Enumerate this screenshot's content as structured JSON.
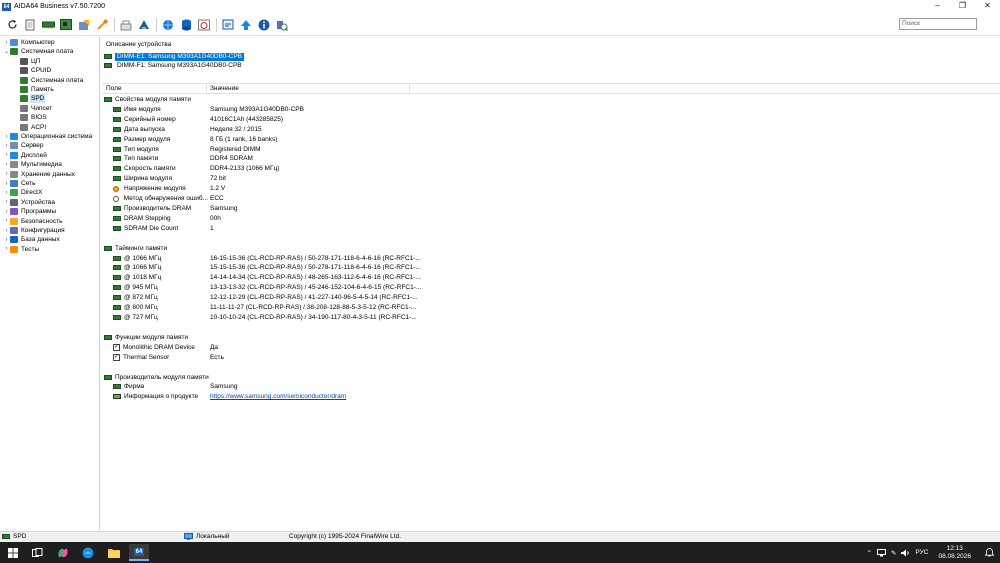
{
  "window": {
    "title": "AIDA64 Business v7.50.7200",
    "icon_text": "64",
    "minimize": "–",
    "maximize": "❐",
    "close": "✕"
  },
  "toolbar": {
    "buttons": [
      "refresh-icon",
      "report-icon",
      "memory-icon",
      "motherboard-icon",
      "favorites-icon",
      "cpu-icon",
      "wrench-icon",
      "user-icon",
      "network-icon",
      "database-icon",
      "benchmark-icon",
      "report-wizard-icon",
      "export-icon",
      "info-icon",
      "help-icon"
    ],
    "search_placeholder": "Поиск"
  },
  "tree": {
    "items": [
      {
        "label": "Компьютер",
        "indent": 0,
        "expand": "›",
        "icon_color": "#4a90d9"
      },
      {
        "label": "Системная плата",
        "indent": 0,
        "expand": "⌄",
        "icon_color": "#2e7d32"
      },
      {
        "label": "ЦП",
        "indent": 1,
        "expand": "",
        "icon_color": "#555555"
      },
      {
        "label": "CPUID",
        "indent": 1,
        "expand": "",
        "icon_color": "#555555"
      },
      {
        "label": "Системная плата",
        "indent": 1,
        "expand": "",
        "icon_color": "#2e7d32"
      },
      {
        "label": "Память",
        "indent": 1,
        "expand": "",
        "icon_color": "#2e7d32"
      },
      {
        "label": "SPD",
        "indent": 1,
        "expand": "",
        "icon_color": "#2e7d32",
        "selected": true
      },
      {
        "label": "Чипсет",
        "indent": 1,
        "expand": "",
        "icon_color": "#777777"
      },
      {
        "label": "BIOS",
        "indent": 1,
        "expand": "",
        "icon_color": "#777777"
      },
      {
        "label": "ACPI",
        "indent": 1,
        "expand": "",
        "icon_color": "#777777"
      },
      {
        "label": "Операционная система",
        "indent": 0,
        "expand": "›",
        "icon_color": "#1e88e5"
      },
      {
        "label": "Сервер",
        "indent": 0,
        "expand": "›",
        "icon_color": "#6d8fb3"
      },
      {
        "label": "Дисплей",
        "indent": 0,
        "expand": "›",
        "icon_color": "#1e88e5"
      },
      {
        "label": "Мультимедиа",
        "indent": 0,
        "expand": "›",
        "icon_color": "#888888"
      },
      {
        "label": "Хранение данных",
        "indent": 0,
        "expand": "›",
        "icon_color": "#888888"
      },
      {
        "label": "Сеть",
        "indent": 0,
        "expand": "›",
        "icon_color": "#3f7fbf"
      },
      {
        "label": "DirectX",
        "indent": 0,
        "expand": "›",
        "icon_color": "#43a047"
      },
      {
        "label": "Устройства",
        "indent": 0,
        "expand": "›",
        "icon_color": "#666666"
      },
      {
        "label": "Программы",
        "indent": 0,
        "expand": "›",
        "icon_color": "#7e57c2"
      },
      {
        "label": "Безопасность",
        "indent": 0,
        "expand": "›",
        "icon_color": "#f9a825"
      },
      {
        "label": "Конфигурация",
        "indent": 0,
        "expand": "›",
        "icon_color": "#5c6bc0"
      },
      {
        "label": "База данных",
        "indent": 0,
        "expand": "›",
        "icon_color": "#1565c0"
      },
      {
        "label": "Тесты",
        "indent": 0,
        "expand": "›",
        "icon_color": "#fb8c00"
      }
    ]
  },
  "devices": {
    "header": "Описание устройства",
    "items": [
      {
        "label": "DIMM-E1: Samsung M393A1G40DB0-CPB",
        "selected": true
      },
      {
        "label": "DIMM-F1: Samsung M393A1G40DB0-CPB",
        "selected": false
      }
    ]
  },
  "columns": {
    "field": "Поле",
    "value": "Значение"
  },
  "groups": [
    {
      "title": "Свойства модуля памяти",
      "rows": [
        {
          "field": "Имя модуля",
          "value": "Samsung M393A1G40DB0-CPB",
          "icon": "module"
        },
        {
          "field": "Серийный номер",
          "value": "41016C1Ah (443285825)",
          "icon": "module"
        },
        {
          "field": "Дата выпуска",
          "value": "Неделя 32 / 2015",
          "icon": "module"
        },
        {
          "field": "Размер модуля",
          "value": "8 ГБ (1 rank, 16 banks)",
          "icon": "module"
        },
        {
          "field": "Тип модуля",
          "value": "Registered DIMM",
          "icon": "module"
        },
        {
          "field": "Тип памяти",
          "value": "DDR4 SDRAM",
          "icon": "module"
        },
        {
          "field": "Скорость памяти",
          "value": "DDR4-2133 (1066 МГц)",
          "icon": "module"
        },
        {
          "field": "Ширина модуля",
          "value": "72 bit",
          "icon": "module"
        },
        {
          "field": "Напряжение модуля",
          "value": "1.2 V",
          "icon": "voltage"
        },
        {
          "field": "Метод обнаружения ошиб...",
          "value": "ECC",
          "icon": "search"
        },
        {
          "field": "Производитель DRAM",
          "value": "Samsung",
          "icon": "module"
        },
        {
          "field": "DRAM Stepping",
          "value": "00h",
          "icon": "module"
        },
        {
          "field": "SDRAM Die Count",
          "value": "1",
          "icon": "module"
        }
      ]
    },
    {
      "title": "Тайминги памяти",
      "rows": [
        {
          "field": "@ 1066 МГц",
          "value": "16-15-15-36  (CL-RCD-RP-RAS) / 50-278-171-118-6-4-6-16  (RC-RFC1-...",
          "icon": "module"
        },
        {
          "field": "@ 1066 МГц",
          "value": "15-15-15-36  (CL-RCD-RP-RAS) / 50-278-171-118-6-4-6-16  (RC-RFC1-...",
          "icon": "module"
        },
        {
          "field": "@ 1018 МГц",
          "value": "14-14-14-34  (CL-RCD-RP-RAS) / 48-265-163-112-6-4-6-16  (RC-RFC1-...",
          "icon": "module"
        },
        {
          "field": "@ 945 МГц",
          "value": "13-13-13-32  (CL-RCD-RP-RAS) / 45-246-152-104-6-4-6-15  (RC-RFC1-...",
          "icon": "module"
        },
        {
          "field": "@ 872 МГц",
          "value": "12-12-12-29  (CL-RCD-RP-RAS) / 41-227-140-96-5-4-5-14  (RC-RFC1-...",
          "icon": "module"
        },
        {
          "field": "@ 800 МГц",
          "value": "11-11-11-27  (CL-RCD-RP-RAS) / 38-208-128-88-5-3-5-12  (RC-RFC1-...",
          "icon": "module"
        },
        {
          "field": "@ 727 МГц",
          "value": "10-10-10-24  (CL-RCD-RP-RAS) / 34-190-117-80-4-3-5-11  (RC-RFC1-...",
          "icon": "module"
        }
      ]
    },
    {
      "title": "Функции модуля памяти",
      "rows": [
        {
          "field": "Monolithic DRAM Device",
          "value": "Да",
          "icon": "check"
        },
        {
          "field": "Thermal Sensor",
          "value": "Есть",
          "icon": "check"
        }
      ]
    },
    {
      "title": "Производитель модуля памяти",
      "rows": [
        {
          "field": "Фирма",
          "value": "Samsung",
          "icon": "module"
        },
        {
          "field": "Информация о продукте",
          "value": "https://www.samsung.com/semiconductor/dram",
          "icon": "web",
          "link": true
        }
      ]
    }
  ],
  "statusbar": {
    "left": "SPD",
    "mid": "Локальный",
    "right": "Copyright (c) 1995-2024 FinalWire Ltd."
  },
  "taskbar": {
    "apps": [
      "start-icon",
      "task-view-icon",
      "copilot-icon",
      "edge-icon",
      "file-explorer-icon",
      "aida64-icon"
    ],
    "tray_lang": "РУС",
    "time": "12:13",
    "date": "08.08.2026"
  }
}
